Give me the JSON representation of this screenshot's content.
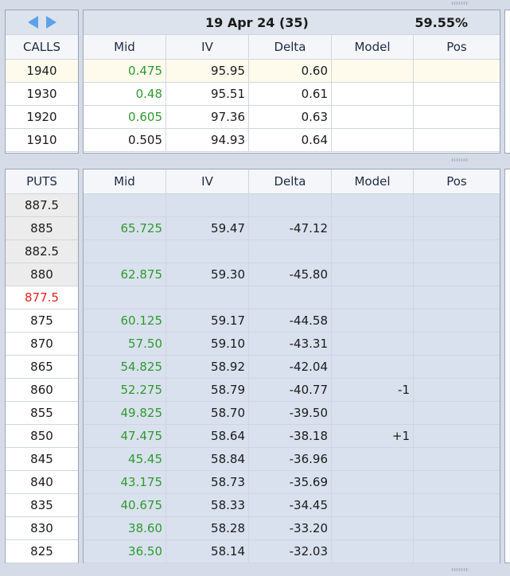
{
  "nav": {
    "prev_icon": "triangle-left-icon",
    "next_icon": "triangle-right-icon"
  },
  "expiry": {
    "label": "19 Apr 24 (35)",
    "atm_iv": "59.55%"
  },
  "columns": [
    "Mid",
    "IV",
    "Delta",
    "Model",
    "Pos"
  ],
  "calls": {
    "header": "CALLS",
    "rows": [
      {
        "strike": "1940",
        "mid": "0.475",
        "mid_green": true,
        "iv": "95.95",
        "delta": "0.60",
        "model": "",
        "pos": "",
        "highlight": true
      },
      {
        "strike": "1930",
        "mid": "0.48",
        "mid_green": true,
        "iv": "95.51",
        "delta": "0.61",
        "model": "",
        "pos": ""
      },
      {
        "strike": "1920",
        "mid": "0.605",
        "mid_green": true,
        "iv": "97.36",
        "delta": "0.63",
        "model": "",
        "pos": ""
      },
      {
        "strike": "1910",
        "mid": "0.505",
        "mid_green": false,
        "iv": "94.93",
        "delta": "0.64",
        "model": "",
        "pos": ""
      }
    ]
  },
  "puts": {
    "header": "PUTS",
    "rows": [
      {
        "strike": "887.5",
        "mid": "",
        "iv": "",
        "delta": "",
        "model": "",
        "pos": "",
        "strike_style": "grey"
      },
      {
        "strike": "885",
        "mid": "65.725",
        "iv": "59.47",
        "delta": "-47.12",
        "model": "",
        "pos": "",
        "strike_style": "grey"
      },
      {
        "strike": "882.5",
        "mid": "",
        "iv": "",
        "delta": "",
        "model": "",
        "pos": "",
        "strike_style": "grey"
      },
      {
        "strike": "880",
        "mid": "62.875",
        "iv": "59.30",
        "delta": "-45.80",
        "model": "",
        "pos": "",
        "strike_style": "grey"
      },
      {
        "strike": "877.5",
        "mid": "",
        "iv": "",
        "delta": "",
        "model": "",
        "pos": "",
        "strike_style": "red"
      },
      {
        "strike": "875",
        "mid": "60.125",
        "iv": "59.17",
        "delta": "-44.58",
        "model": "",
        "pos": ""
      },
      {
        "strike": "870",
        "mid": "57.50",
        "iv": "59.10",
        "delta": "-43.31",
        "model": "",
        "pos": ""
      },
      {
        "strike": "865",
        "mid": "54.825",
        "iv": "58.92",
        "delta": "-42.04",
        "model": "",
        "pos": ""
      },
      {
        "strike": "860",
        "mid": "52.275",
        "iv": "58.79",
        "delta": "-40.77",
        "model": "-1",
        "pos": ""
      },
      {
        "strike": "855",
        "mid": "49.825",
        "iv": "58.70",
        "delta": "-39.50",
        "model": "",
        "pos": ""
      },
      {
        "strike": "850",
        "mid": "47.475",
        "iv": "58.64",
        "delta": "-38.18",
        "model": "+1",
        "pos": ""
      },
      {
        "strike": "845",
        "mid": "45.45",
        "iv": "58.84",
        "delta": "-36.96",
        "model": "",
        "pos": ""
      },
      {
        "strike": "840",
        "mid": "43.175",
        "iv": "58.73",
        "delta": "-35.69",
        "model": "",
        "pos": ""
      },
      {
        "strike": "835",
        "mid": "40.675",
        "iv": "58.33",
        "delta": "-34.45",
        "model": "",
        "pos": ""
      },
      {
        "strike": "830",
        "mid": "38.60",
        "iv": "58.28",
        "delta": "-33.20",
        "model": "",
        "pos": ""
      },
      {
        "strike": "825",
        "mid": "36.50",
        "iv": "58.14",
        "delta": "-32.03",
        "model": "",
        "pos": ""
      }
    ]
  },
  "colors": {
    "mid_green": "#2e9a2e",
    "atm_strike_red": "#ee1c1c",
    "highlight_row": "#fefbed",
    "puts_background": "#d9e1ee",
    "nav_arrow": "#5aa3e6"
  }
}
